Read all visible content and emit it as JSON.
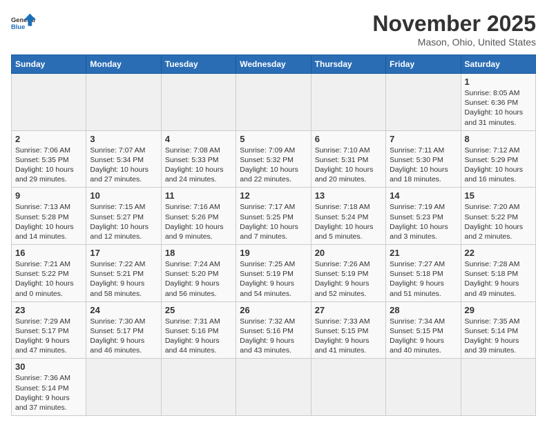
{
  "header": {
    "logo_general": "General",
    "logo_blue": "Blue",
    "month_title": "November 2025",
    "location": "Mason, Ohio, United States"
  },
  "days_of_week": [
    "Sunday",
    "Monday",
    "Tuesday",
    "Wednesday",
    "Thursday",
    "Friday",
    "Saturday"
  ],
  "weeks": [
    [
      {
        "day": "",
        "info": ""
      },
      {
        "day": "",
        "info": ""
      },
      {
        "day": "",
        "info": ""
      },
      {
        "day": "",
        "info": ""
      },
      {
        "day": "",
        "info": ""
      },
      {
        "day": "",
        "info": ""
      },
      {
        "day": "1",
        "info": "Sunrise: 8:05 AM\nSunset: 6:36 PM\nDaylight: 10 hours and 31 minutes."
      }
    ],
    [
      {
        "day": "2",
        "info": "Sunrise: 7:06 AM\nSunset: 5:35 PM\nDaylight: 10 hours and 29 minutes."
      },
      {
        "day": "3",
        "info": "Sunrise: 7:07 AM\nSunset: 5:34 PM\nDaylight: 10 hours and 27 minutes."
      },
      {
        "day": "4",
        "info": "Sunrise: 7:08 AM\nSunset: 5:33 PM\nDaylight: 10 hours and 24 minutes."
      },
      {
        "day": "5",
        "info": "Sunrise: 7:09 AM\nSunset: 5:32 PM\nDaylight: 10 hours and 22 minutes."
      },
      {
        "day": "6",
        "info": "Sunrise: 7:10 AM\nSunset: 5:31 PM\nDaylight: 10 hours and 20 minutes."
      },
      {
        "day": "7",
        "info": "Sunrise: 7:11 AM\nSunset: 5:30 PM\nDaylight: 10 hours and 18 minutes."
      },
      {
        "day": "8",
        "info": "Sunrise: 7:12 AM\nSunset: 5:29 PM\nDaylight: 10 hours and 16 minutes."
      }
    ],
    [
      {
        "day": "9",
        "info": "Sunrise: 7:13 AM\nSunset: 5:28 PM\nDaylight: 10 hours and 14 minutes."
      },
      {
        "day": "10",
        "info": "Sunrise: 7:15 AM\nSunset: 5:27 PM\nDaylight: 10 hours and 12 minutes."
      },
      {
        "day": "11",
        "info": "Sunrise: 7:16 AM\nSunset: 5:26 PM\nDaylight: 10 hours and 9 minutes."
      },
      {
        "day": "12",
        "info": "Sunrise: 7:17 AM\nSunset: 5:25 PM\nDaylight: 10 hours and 7 minutes."
      },
      {
        "day": "13",
        "info": "Sunrise: 7:18 AM\nSunset: 5:24 PM\nDaylight: 10 hours and 5 minutes."
      },
      {
        "day": "14",
        "info": "Sunrise: 7:19 AM\nSunset: 5:23 PM\nDaylight: 10 hours and 3 minutes."
      },
      {
        "day": "15",
        "info": "Sunrise: 7:20 AM\nSunset: 5:22 PM\nDaylight: 10 hours and 2 minutes."
      }
    ],
    [
      {
        "day": "16",
        "info": "Sunrise: 7:21 AM\nSunset: 5:22 PM\nDaylight: 10 hours and 0 minutes."
      },
      {
        "day": "17",
        "info": "Sunrise: 7:22 AM\nSunset: 5:21 PM\nDaylight: 9 hours and 58 minutes."
      },
      {
        "day": "18",
        "info": "Sunrise: 7:24 AM\nSunset: 5:20 PM\nDaylight: 9 hours and 56 minutes."
      },
      {
        "day": "19",
        "info": "Sunrise: 7:25 AM\nSunset: 5:19 PM\nDaylight: 9 hours and 54 minutes."
      },
      {
        "day": "20",
        "info": "Sunrise: 7:26 AM\nSunset: 5:19 PM\nDaylight: 9 hours and 52 minutes."
      },
      {
        "day": "21",
        "info": "Sunrise: 7:27 AM\nSunset: 5:18 PM\nDaylight: 9 hours and 51 minutes."
      },
      {
        "day": "22",
        "info": "Sunrise: 7:28 AM\nSunset: 5:18 PM\nDaylight: 9 hours and 49 minutes."
      }
    ],
    [
      {
        "day": "23",
        "info": "Sunrise: 7:29 AM\nSunset: 5:17 PM\nDaylight: 9 hours and 47 minutes."
      },
      {
        "day": "24",
        "info": "Sunrise: 7:30 AM\nSunset: 5:17 PM\nDaylight: 9 hours and 46 minutes."
      },
      {
        "day": "25",
        "info": "Sunrise: 7:31 AM\nSunset: 5:16 PM\nDaylight: 9 hours and 44 minutes."
      },
      {
        "day": "26",
        "info": "Sunrise: 7:32 AM\nSunset: 5:16 PM\nDaylight: 9 hours and 43 minutes."
      },
      {
        "day": "27",
        "info": "Sunrise: 7:33 AM\nSunset: 5:15 PM\nDaylight: 9 hours and 41 minutes."
      },
      {
        "day": "28",
        "info": "Sunrise: 7:34 AM\nSunset: 5:15 PM\nDaylight: 9 hours and 40 minutes."
      },
      {
        "day": "29",
        "info": "Sunrise: 7:35 AM\nSunset: 5:14 PM\nDaylight: 9 hours and 39 minutes."
      }
    ],
    [
      {
        "day": "30",
        "info": "Sunrise: 7:36 AM\nSunset: 5:14 PM\nDaylight: 9 hours and 37 minutes."
      },
      {
        "day": "",
        "info": ""
      },
      {
        "day": "",
        "info": ""
      },
      {
        "day": "",
        "info": ""
      },
      {
        "day": "",
        "info": ""
      },
      {
        "day": "",
        "info": ""
      },
      {
        "day": "",
        "info": ""
      }
    ]
  ]
}
